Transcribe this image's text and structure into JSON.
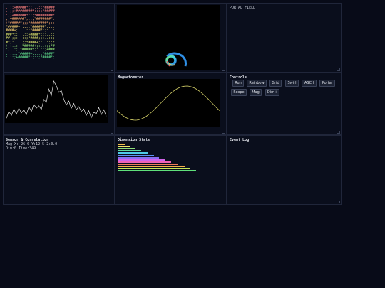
{
  "panels": {
    "ascii_title": "",
    "portal_title": "PORTAL FIELD",
    "magnetometer_title": "Magnetometer",
    "controls_title": "Controls",
    "sensor_title": "Sensor & Correlation",
    "dimension_title": "Dimension Stats",
    "event_title": "Event Log"
  },
  "ascii_rows": [
    "..:;+#####*:: ..;;*#####",
    ".:;;+########*:::;*#####",
    ":;;+######*;;;*########*",
    ";;+######*;::;*#######*:",
    "+*#####*;;;*########*;::",
    "*#####+;;;.;*######*;;.:",
    "####+;;;..:;*####*;;:..:",
    "###*;;:..:;+####*;;:..:;",
    "##+;;:..::;*####;;:..::;",
    "#*;:...:;;*####+;:..:;;*",
    "+;:..::;*#####+;:..:;;*#",
    ":;..:;;*#####*;:.::;+###",
    ";:.::;*#####+;;::;*####*",
    ":.::;+#####*;;::;*####*;"
  ],
  "ascii_palette": [
    "#f07a7a",
    "#f6a56c",
    "#f3cc6e",
    "#d6dd6a",
    "#8fdc72",
    "#5ed98a"
  ],
  "sensor": {
    "mag_line": "Mag X:-26.0 Y:12.5 Z:0.0",
    "dim_line": "Dim:0 Time:349"
  },
  "controls": [
    {
      "name": "run",
      "label": "Run"
    },
    {
      "name": "rainbow",
      "label": "Rainbow"
    },
    {
      "name": "grid",
      "label": "Grid"
    },
    {
      "name": "swirl",
      "label": "Swirl"
    },
    {
      "name": "ascii",
      "label": "ASCII"
    },
    {
      "name": "portal",
      "label": "Portal"
    },
    {
      "name": "scope",
      "label": "Scope"
    },
    {
      "name": "mag",
      "label": "Mag"
    },
    {
      "name": "dim-plus",
      "label": "Dim+"
    }
  ],
  "dimension_stats": {
    "values": [
      0.09,
      0.16,
      0.23,
      0.3,
      0.38,
      0.46,
      0.53,
      0.61,
      0.68,
      0.76,
      0.85,
      0.93,
      1.0
    ],
    "colors": [
      "#f6c14c",
      "#f0e46a",
      "#8ee07a",
      "#5fdc9c",
      "#4fc9e6",
      "#5b8ef0",
      "#8a6cf2",
      "#d064e8",
      "#f062b6",
      "#f07a5a",
      "#f6b04a",
      "#c6e85a",
      "#5fe07a"
    ]
  },
  "waveform": [
    0.05,
    0.22,
    0.12,
    0.28,
    0.15,
    0.3,
    0.18,
    0.26,
    0.14,
    0.34,
    0.22,
    0.4,
    0.3,
    0.36,
    0.27,
    0.52,
    0.45,
    0.78,
    0.62,
    0.98,
    0.86,
    0.7,
    0.74,
    0.52,
    0.38,
    0.48,
    0.3,
    0.42,
    0.26,
    0.34,
    0.22,
    0.28,
    0.12,
    0.24,
    0.06,
    0.2,
    0.16,
    0.32,
    0.14,
    0.26,
    0.1
  ],
  "magnetometer": {
    "cycles": 1.0,
    "phase": 3.6,
    "amplitude": 0.8,
    "color": "#d8d46a"
  },
  "colors": {
    "accent": "#d8d46a"
  }
}
